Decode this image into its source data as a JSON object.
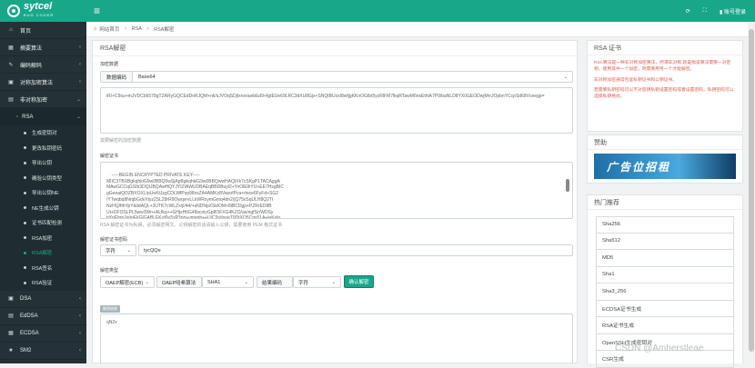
{
  "brand": {
    "name": "sytcel",
    "sub": "BUG CODER"
  },
  "topbar": {
    "menu_icon": "hamburger-icon",
    "refresh_icon": "refresh-icon",
    "expand_icon": "fullscreen-icon",
    "user_label": "账号登录"
  },
  "sidebar": {
    "items": [
      {
        "label": "首页",
        "icon": "home-icon"
      },
      {
        "label": "摘要算法",
        "icon": "digest-icon"
      },
      {
        "label": "编码解码",
        "icon": "code-icon"
      },
      {
        "label": "对称加密算法",
        "icon": "sym-icon"
      },
      {
        "label": "非对称加密",
        "icon": "asym-icon"
      }
    ],
    "rsa_label": "RSA",
    "rsa_items": [
      "生成密钥对",
      "更改私钥密码",
      "导出公钥",
      "确验公钥类型",
      "导出公钥NE",
      "NE生成公钥",
      "证书匹配检测",
      "RSA加密",
      "RSA解密",
      "RSA签名",
      "RSA验证"
    ],
    "active_index": 8,
    "bottom_items": [
      {
        "label": "DSA",
        "icon": "dsa-icon"
      },
      {
        "label": "EdDSA",
        "icon": "eddsa-icon"
      },
      {
        "label": "ECDSA",
        "icon": "ecdsa-icon"
      },
      {
        "label": "SM2",
        "icon": "star-icon"
      },
      {
        "label": "Gost",
        "icon": "gost-icon"
      }
    ]
  },
  "breadcrumb": {
    "home": "网站首页",
    "level1": "RSA",
    "level2": "RSA解密"
  },
  "main": {
    "title": "RSA解密",
    "data_label": "加密数据",
    "encoding_prefix": "数据编码",
    "encoding_value": "Base64",
    "ciphertext": "iR/+C9su+mJVDCb6578gTZARyGQCEdDnRJQM+nk/sJVOqSDjIxroxiuebEd9+fgtEUe69LRC3dXU8Gjs+SNQtBUxxI8wfjgKKnOGIbt5yzRlFM7lkqRTawM6nsEthlA7P9/baNLD8YX0GEODwjMrrJOpbnYCcpSd68Vceegp=",
    "data_hint": "需要解密的加密数据",
    "key_label": "解密证书",
    "private_key": "-----BEGIN ENCRYPTED PRIVATE KEY-----\nMIIC3TBXBgkqhkiG9w0BBQ0wSjApBgkqhkiG9w0BBQwwHAQIXk7cSKgP1TACAggA\nMAwGCCqGSIb3DQIJBQAwHQYJYIZIAWUDBAEqBBDBuyl2+YvOlElhYU+EE7HsgBIC\ngGeeaiQOZBXOXL/pUeKtJzgCDLWfPzp98vsZA4AMKz8VaoofPca+rtsce6FyFd+SG2\n/YTwqbq8NrqbGdvXtyz2SL29rR9OwqvrvLLkWRxymGmq4dn2/jQ75vSqULH8Q2Tl\nNzHQ/fthYpYkddAQL+3UTK7cWLZx/jl/44/+sNDNpXSklOM+8iBCDgp+PZRrED8B\nUt+DFOSLPL5ww3Wn+ALfkq++GHjsH6G48scoiyGp8OFXG4KZO/as/ngfSrrWDSy\nhYnEhmJxdqEkGlGABLEKuf0u5xP3pq+vmeph++U/C9sdsoeT9DtXO5Cgx51A+leKxlq",
    "key_hint": "RSA 解密证书为私钥，必须解密明文。公钥解密的话请输入公钥，需要使用 PEM 格式证书",
    "password_label": "解密证书密码",
    "password_type": "字符",
    "password_value": "tycQQe",
    "type_label": "解密类型",
    "padding_value": "OAEP解密(ECB)",
    "hash_label": "OAEP哈希算法",
    "hash_value": "SHA1",
    "result_encoding_label": "结果编码",
    "result_encoding_value": "字符",
    "decrypt_button": "确认解密",
    "result_tag": "解密结果",
    "result_value": "qN2x"
  },
  "right": {
    "rsa_title": "RSA 证书",
    "rsa_text1": "RSA算法是一种非对称加密算法，所谓非对称,就是指该算法需要一对密钥，使用其中一个加密，则需要用另一个才能解密。",
    "rsa_text2": "非对称加密通常包含私钥证书和公钥证书。",
    "rsa_text3": "若需要私钥密码可以不对密钥私钥设置密码或者设置密码，私钥密码可以选择私钥格式。",
    "sponsor_title": "赞助",
    "ad_text": "广告位招租",
    "hot_title": "热门推荐",
    "hot_items": [
      "Sha256",
      "Sha512",
      "MD5",
      "Sha1",
      "Sha3_256",
      "ECDSA证书生成",
      "RSA证书生成",
      "OpenSSH生成密钥对",
      "CSR生成"
    ]
  },
  "watermark": "CSDN @Amherstleae"
}
